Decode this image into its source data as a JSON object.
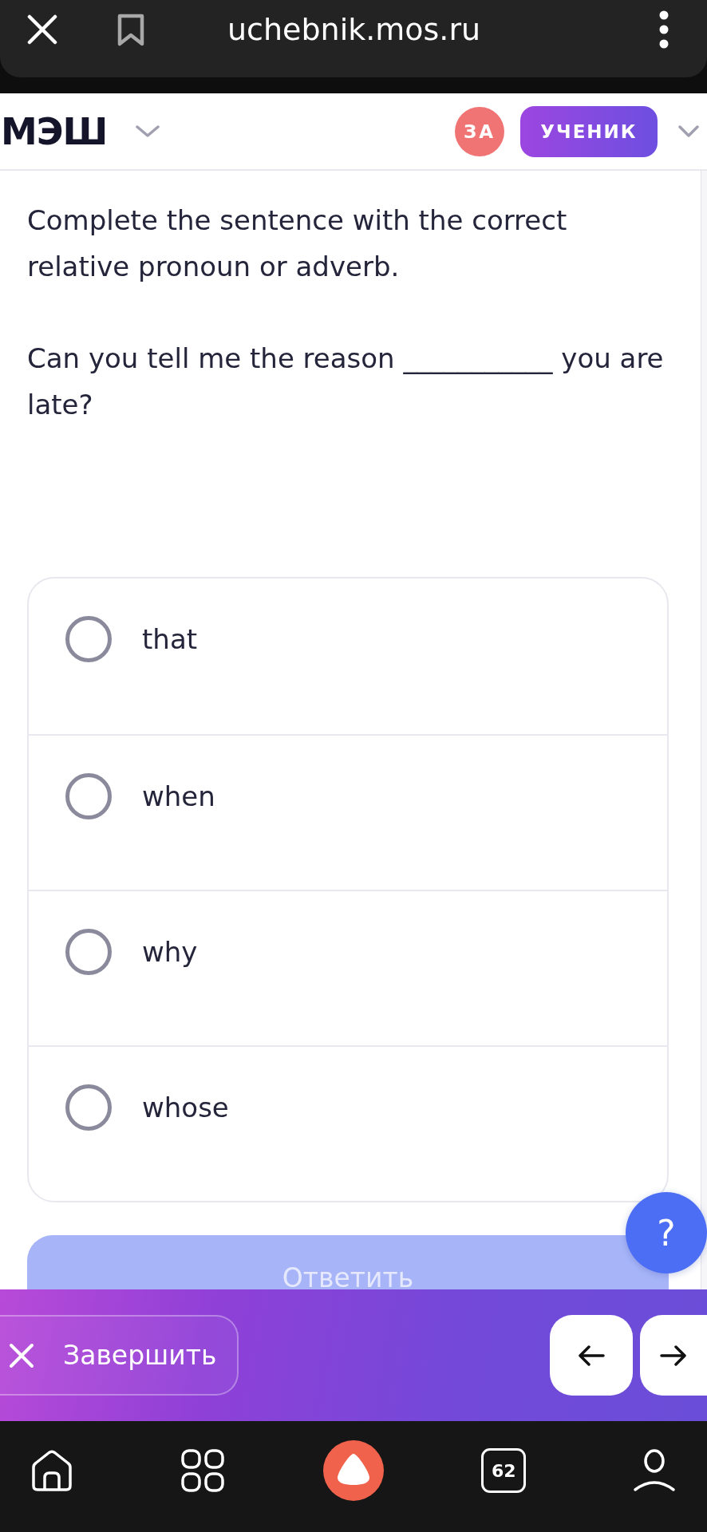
{
  "browser": {
    "url": "uchebnik.mos.ru"
  },
  "header": {
    "logo": "МЭШ",
    "avatar_initials": "ЗА",
    "role": "УЧЕНИК"
  },
  "question": {
    "instruction": "Complete the sentence with the correct relative pronoun or adverb.",
    "sentence": "Can you tell me the reason ___________ you are late?"
  },
  "options": [
    {
      "label": "that",
      "selected": false
    },
    {
      "label": "when",
      "selected": false
    },
    {
      "label": "why",
      "selected": false
    },
    {
      "label": "whose",
      "selected": false
    }
  ],
  "answer_button": {
    "label": "Ответить",
    "disabled": true
  },
  "help_button": {
    "label": "?"
  },
  "action_bar": {
    "finish_label": "Завершить"
  },
  "bottom_nav": {
    "tabs_count": "62"
  }
}
